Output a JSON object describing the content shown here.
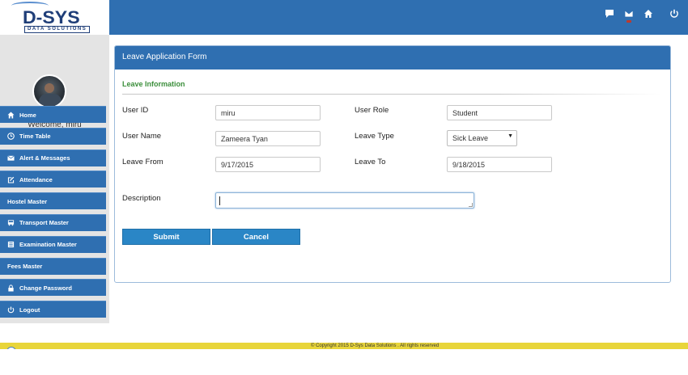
{
  "header": {
    "logo_text": "D-SYS",
    "logo_tagline": "DATA SOLUTIONS",
    "icons": [
      "chat-icon",
      "mail-icon",
      "home-icon",
      "power-icon"
    ]
  },
  "sidebar": {
    "welcome": "Welcome, miru",
    "items": [
      {
        "label": "Home",
        "icon": "home-icon"
      },
      {
        "label": "Time Table",
        "icon": "clock-icon"
      },
      {
        "label": "Alert & Messages",
        "icon": "mail-icon"
      },
      {
        "label": "Attendance",
        "icon": "edit-icon"
      },
      {
        "label": "Hostel Master",
        "icon": ""
      },
      {
        "label": "Transport Master",
        "icon": "bus-icon"
      },
      {
        "label": "Examination Master",
        "icon": "list-icon"
      },
      {
        "label": "Fees Master",
        "icon": ""
      },
      {
        "label": "Change Password",
        "icon": "lock-icon"
      },
      {
        "label": "Logout",
        "icon": "power-icon"
      }
    ]
  },
  "form": {
    "title": "Leave Application Form",
    "section": "Leave Information",
    "user_id_label": "User ID",
    "user_id_value": "miru",
    "user_role_label": "User Role",
    "user_role_value": "Student",
    "user_name_label": "User Name",
    "user_name_value": "Zameera Tyan",
    "leave_type_label": "Leave Type",
    "leave_type_value": "Sick Leave",
    "leave_from_label": "Leave From",
    "leave_from_value": "9/17/2015",
    "leave_to_label": "Leave To",
    "leave_to_value": "9/18/2015",
    "description_label": "Description",
    "description_value": "",
    "submit_label": "Submit",
    "cancel_label": "Cancel"
  },
  "footer": {
    "text": "© Copyright 2015 D-Sys Data Solutions . All rights reserved"
  },
  "colors": {
    "primary": "#2f6fb1",
    "button": "#2a86c6",
    "section_title": "#3c8f3c",
    "footer": "#e8d53a"
  }
}
